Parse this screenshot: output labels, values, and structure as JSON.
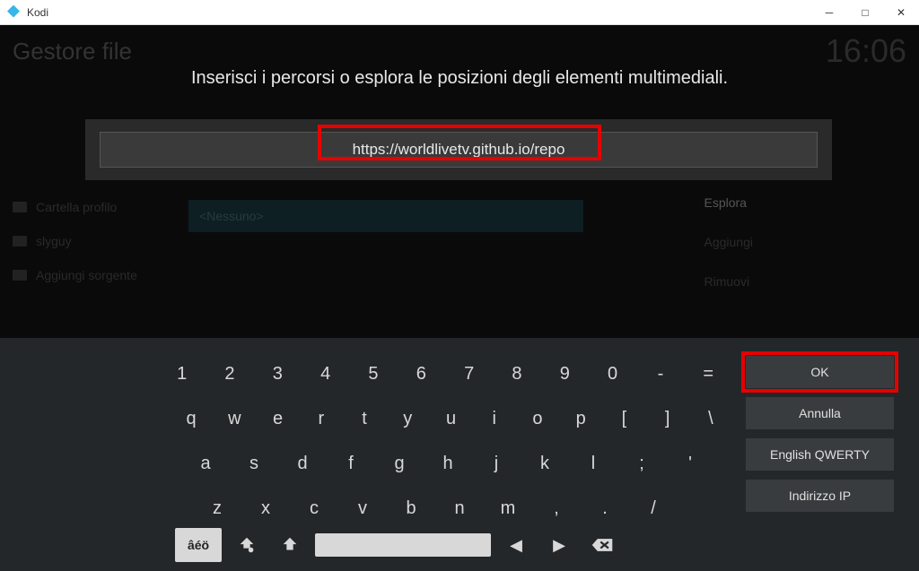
{
  "window": {
    "title": "Kodi"
  },
  "background": {
    "header": "Gestore file",
    "clock": "16:06",
    "sidebar": [
      "Cartella profilo",
      "slyguy",
      "Aggiungi sorgente"
    ],
    "nessuno": "<Nessuno>",
    "buttons": {
      "esplora": "Esplora",
      "aggiungi": "Aggiungi",
      "rimuovi": "Rimuovi"
    }
  },
  "dialog": {
    "instruction": "Inserisci i percorsi o esplora le posizioni degli elementi multimediali.",
    "url_value": "https://worldlivetv.github.io/repo"
  },
  "keyboard": {
    "rows": [
      [
        "1",
        "2",
        "3",
        "4",
        "5",
        "6",
        "7",
        "8",
        "9",
        "0",
        "-",
        "="
      ],
      [
        "q",
        "w",
        "e",
        "r",
        "t",
        "y",
        "u",
        "i",
        "o",
        "p",
        "[",
        "]",
        "\\"
      ],
      [
        "a",
        "s",
        "d",
        "f",
        "g",
        "h",
        "j",
        "k",
        "l",
        ";",
        "'"
      ],
      [
        "z",
        "x",
        "c",
        "v",
        "b",
        "n",
        "m",
        ",",
        ".",
        "/"
      ]
    ],
    "accent_label": "âéö"
  },
  "actions": {
    "ok": "OK",
    "cancel": "Annulla",
    "layout": "English QWERTY",
    "ip": "Indirizzo IP"
  }
}
